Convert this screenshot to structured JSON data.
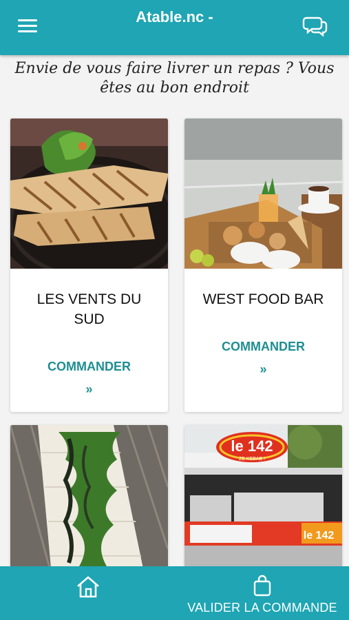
{
  "header": {
    "title": "Atable.nc -",
    "menu_icon": "hamburger-menu-icon",
    "chat_icon": "chat-bubbles-icon"
  },
  "tagline": "Envie de vous faire livrer un repas ? Vous êtes au bon endroit",
  "restaurants": [
    {
      "name": "LES VENTS DU SUD",
      "cta": "COMMANDER",
      "chevron": "»"
    },
    {
      "name": "WEST FOOD BAR",
      "cta": "COMMANDER",
      "chevron": "»"
    },
    {
      "name": "",
      "cta": "",
      "chevron": ""
    },
    {
      "name": "",
      "cta": "",
      "chevron": ""
    }
  ],
  "signs": {
    "kebab_logo": "le 142",
    "kebab_sub": "ZE KEBAB !"
  },
  "footer": {
    "home_icon": "home-icon",
    "validate_label": "VALIDER LA COMMANDE",
    "bag_icon": "shopping-bag-icon"
  },
  "colors": {
    "primary": "#1fa5b3",
    "accent_text": "#1e8e92"
  }
}
